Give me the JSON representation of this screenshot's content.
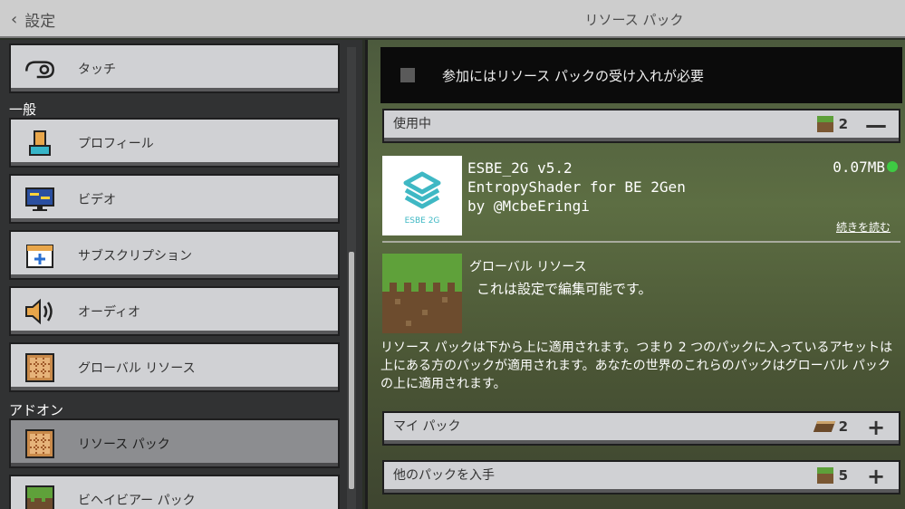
{
  "header": {
    "back_label": "設定",
    "title": "リソース パック"
  },
  "sidebar": {
    "items": [
      {
        "label": "タッチ"
      },
      {
        "label": "プロフィール"
      },
      {
        "label": "ビデオ"
      },
      {
        "label": "サブスクリプション"
      },
      {
        "label": "オーディオ"
      },
      {
        "label": "グローバル リソース"
      },
      {
        "label": "リソース パック"
      },
      {
        "label": "ビヘイビアー パック"
      }
    ],
    "sections": {
      "general": "一般",
      "addons": "アドオン"
    }
  },
  "notice": {
    "text": "参加にはリソース パックの受け入れが必要"
  },
  "active": {
    "title": "使用中",
    "count": "2",
    "action": "—",
    "pack": {
      "icon_text": "ESBE 2G",
      "name": "ESBE_2G v5.2",
      "line2": "EntropyShader for BE 2Gen",
      "line3": "by @McbeEringi",
      "size": "0.07MB",
      "read_more": "続きを読む"
    }
  },
  "global": {
    "title": "グローバル リソース",
    "subtitle": "これは設定で編集可能です。",
    "description": "リソース パックは下から上に適用されます。つまり 2 つのパックに入っているアセットは上にある方のパックが適用されます。あなたの世界のこれらのパックはグローバル パックの上に適用されます。"
  },
  "my_packs": {
    "title": "マイ パック",
    "count": "2",
    "action": "+"
  },
  "get_more": {
    "title": "他のパックを入手",
    "count": "5",
    "action": "+"
  },
  "colors": {
    "accent_green": "#3ecb43",
    "panel_gray": "#d0d1d4",
    "selected_gray": "#8c8d90"
  }
}
